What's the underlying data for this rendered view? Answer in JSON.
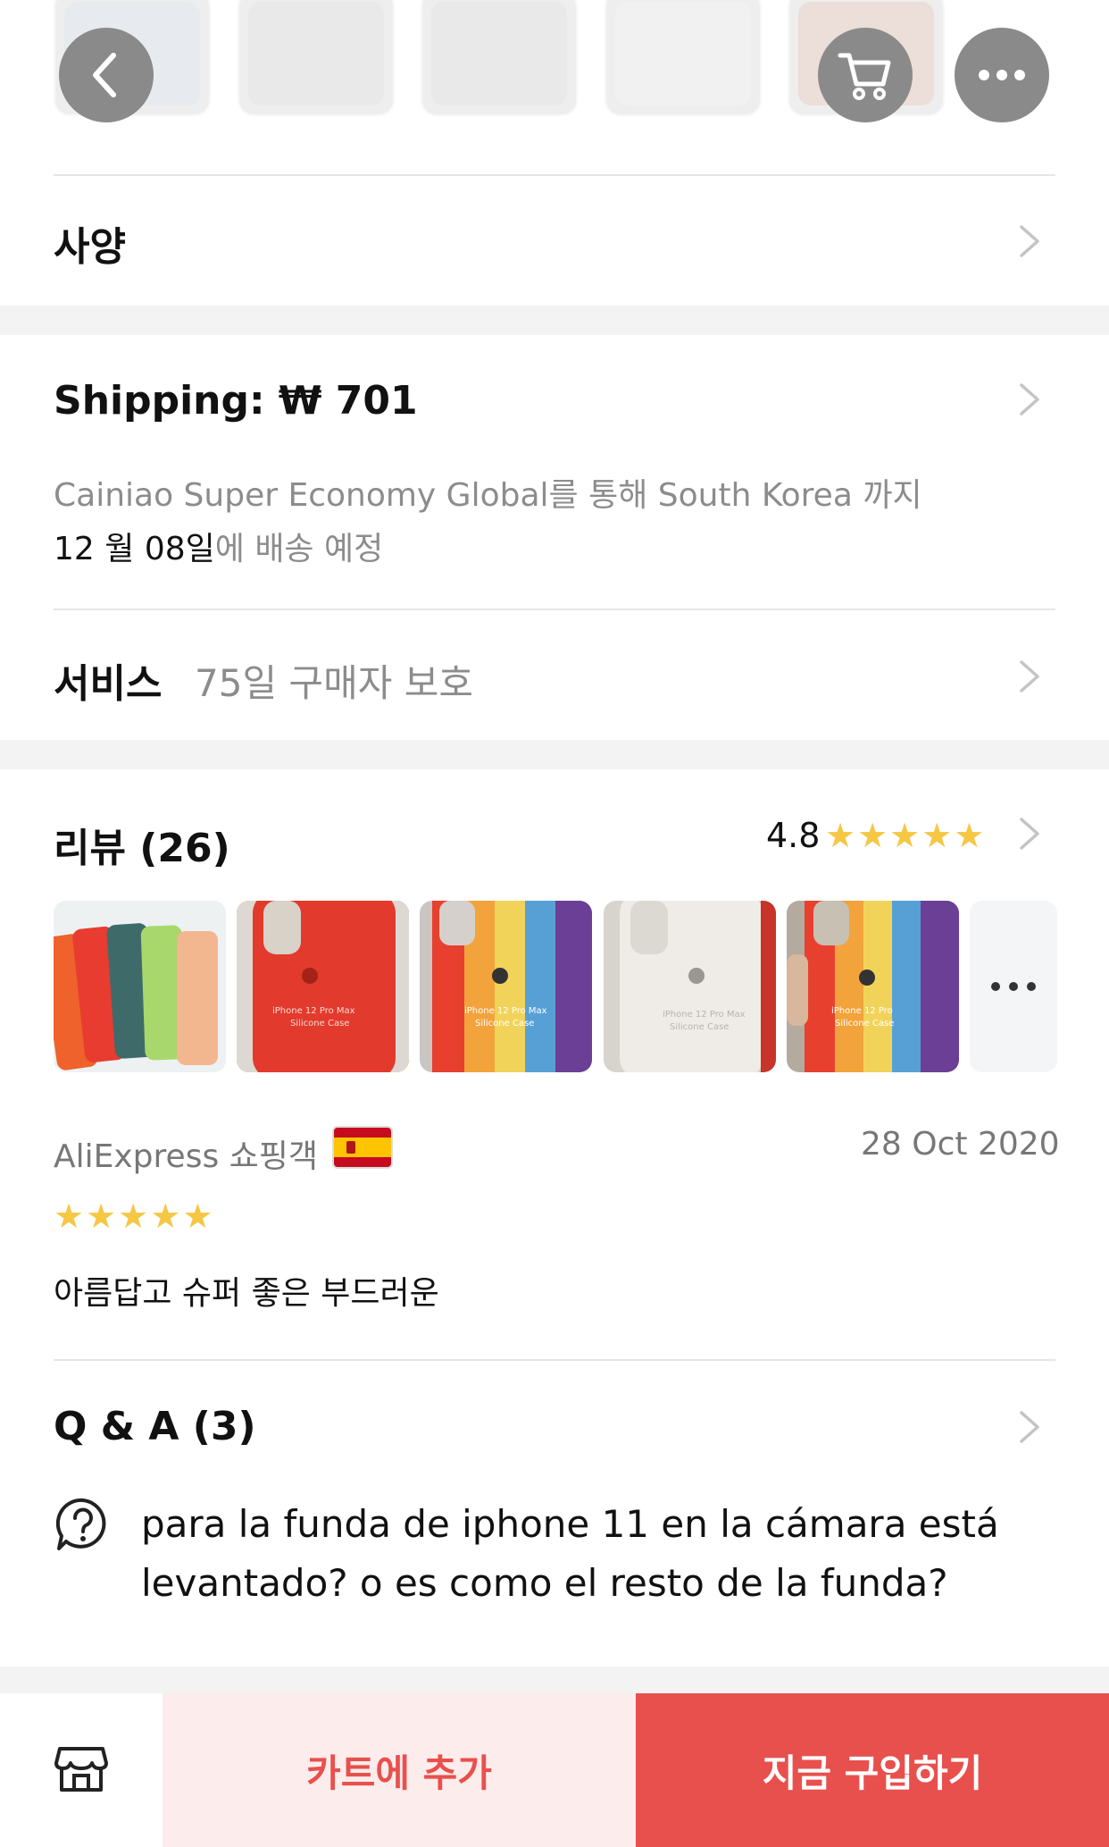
{
  "top_bar": {
    "back_icon": "chevron-left-icon",
    "cart_icon": "cart-icon",
    "more_icon": "more-horizontal-icon"
  },
  "spec": {
    "label": "사양"
  },
  "shipping": {
    "title": "Shipping: ₩ 701",
    "line1": "Cainiao Super Economy Global를 통해 South Korea 까지",
    "date": "12 월 08일",
    "date_suffix": "에 배송 예정"
  },
  "service": {
    "label": "서비스",
    "value": "75일 구매자 보호"
  },
  "reviews": {
    "title": "리뷰 (26)",
    "rating": "4.8",
    "stars": 5,
    "reviewer": "AliExpress 쇼핑객",
    "review_date": "28 Oct 2020",
    "review_stars": 5,
    "review_text": "아름답고 슈퍼 좋은 부드러운",
    "thumbs": [
      {
        "colors": [
          "#f0622b",
          "#e83c31",
          "#3e6b6a",
          "#a8d86b",
          "#f2b78f"
        ]
      },
      {
        "colors": [
          "#e8402f"
        ]
      },
      {
        "colors": [
          "#e8402f",
          "#f3a33b",
          "#f1d35a",
          "#57a0d6",
          "#6b3f95"
        ]
      },
      {
        "colors": [
          "#ebe8e3"
        ]
      },
      {
        "colors": [
          "#e8402f",
          "#f3a33b",
          "#f1d35a",
          "#57a0d6",
          "#6b3f95"
        ]
      }
    ],
    "thumb_captions": [
      "iPhone 12 Pro Max",
      "iPhone 12 Pro Max",
      "iPhone 12 Pro Max",
      "iPhone 12 Pro"
    ],
    "thumb_captions2": [
      "Silicone Case",
      "Silicone Case",
      "Silicone Case",
      "Silicone Case"
    ],
    "flag": "spain-flag"
  },
  "qa": {
    "title": "Q & A (3)",
    "question_line1": "para la funda de iphone 11 en la cámara está",
    "question_line2": "levantado? o es como el resto de la funda?"
  },
  "bottom": {
    "add_to_cart": "카트에 추가",
    "buy_now": "지금 구입하기"
  }
}
